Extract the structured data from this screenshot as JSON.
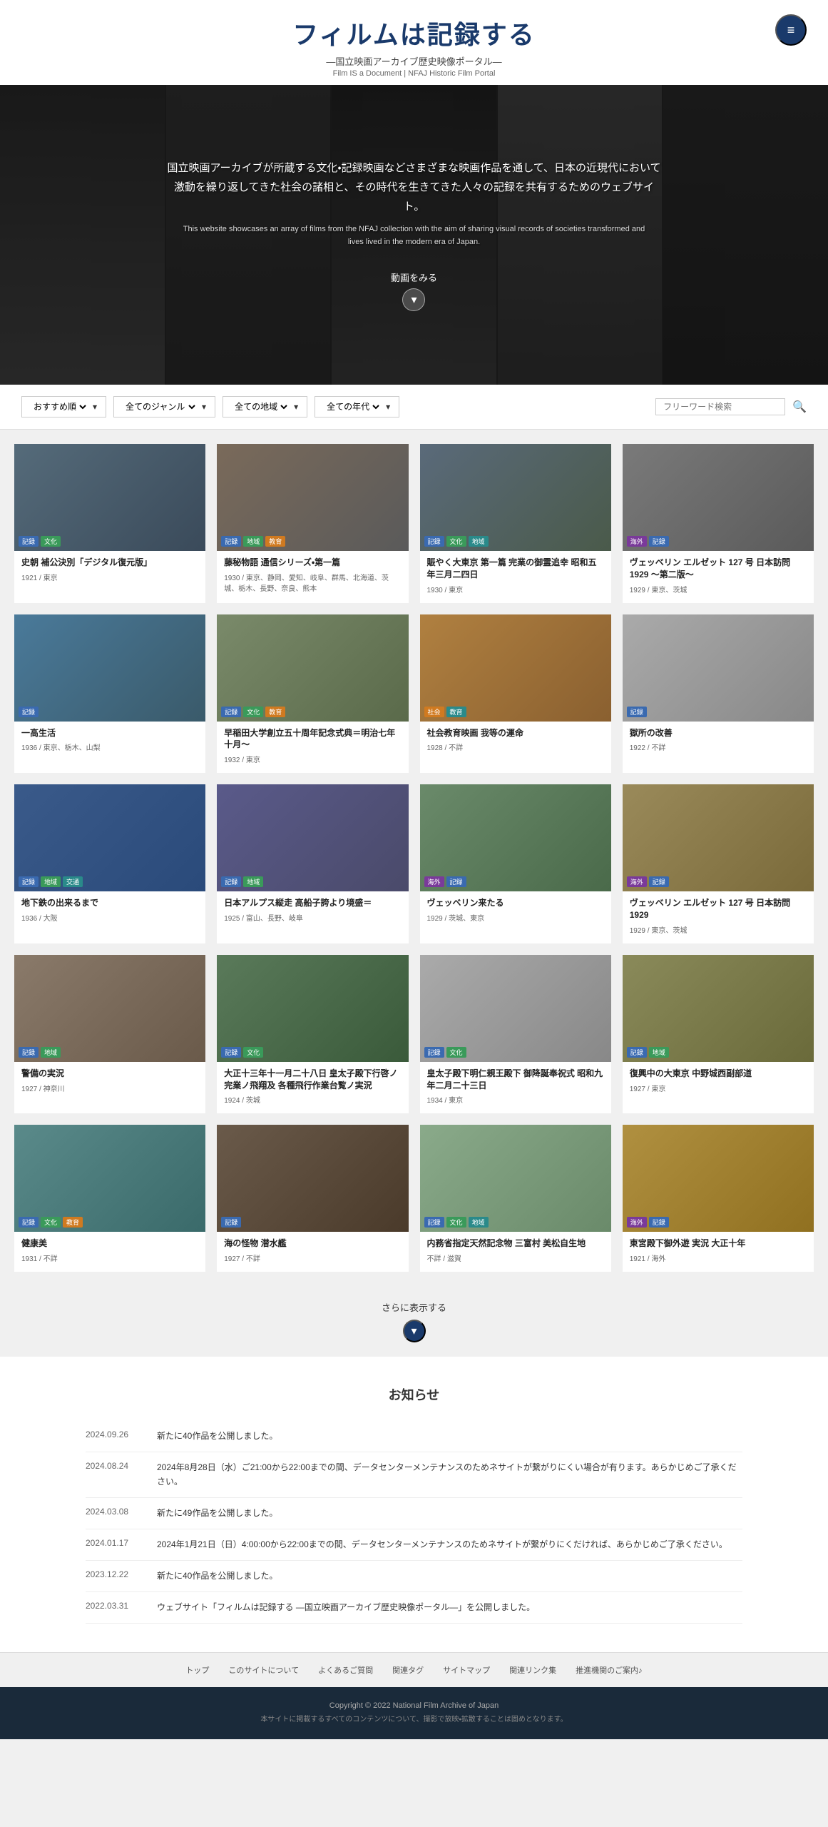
{
  "header": {
    "title": "フィルムは記録する",
    "subtitle": "―国立映画アーカイブ歴史映像ポータル―",
    "subtitle_en": "Film IS a Document | NFAJ Historic Film Portal",
    "menu_icon": "≡"
  },
  "hero": {
    "text_ja": "国立映画アーカイブが所蔵する文化・記録映画などさまざまな映画作品を通して、日本の近現代において激動を繰り返してきた社会の諸相と、その時代を生きてきた人々の記録を共有するためのウェブサイト。",
    "text_en": "This website showcases an array of films from the NFAJ collection with the aim of sharing visual records of societies transformed and lives lived in the modern era of Japan.",
    "watch_label": "動画をみる"
  },
  "filters": {
    "recommended": "おすすめ順",
    "genre": "全てのジャンル",
    "region": "全ての地域",
    "year": "全ての年代",
    "search_placeholder": "フリーワード検索"
  },
  "films": [
    {
      "id": 1,
      "thumb_class": "t1",
      "tags": [
        {
          "label": "記録",
          "color": "blue"
        },
        {
          "label": "文化",
          "color": "green"
        }
      ],
      "title": "史朝 補公決別「デジタル復元版」",
      "meta": "1921 / 東京",
      "extra_meta": ""
    },
    {
      "id": 2,
      "thumb_class": "t2",
      "tags": [
        {
          "label": "記録",
          "color": "blue"
        },
        {
          "label": "地域",
          "color": "green"
        },
        {
          "label": "教育",
          "color": "orange"
        }
      ],
      "title": "藤秘物語 通信シリーズ・第一篇",
      "meta": "1930 / 東京、静岡、愛知、岐阜、群馬、北海道、茨城、栃木、長野、奈良、熊本",
      "extra_meta": ""
    },
    {
      "id": 3,
      "thumb_class": "t3",
      "tags": [
        {
          "label": "記録",
          "color": "blue"
        },
        {
          "label": "文化",
          "color": "green"
        },
        {
          "label": "地域",
          "color": "teal"
        }
      ],
      "title": "賑やく大東京 第一篇 完業の御霊追幸 昭和五年三月二四日",
      "meta": "1930 / 東京",
      "extra_meta": ""
    },
    {
      "id": 4,
      "thumb_class": "t4",
      "tags": [
        {
          "label": "海外",
          "color": "purple"
        },
        {
          "label": "記録",
          "color": "blue"
        }
      ],
      "title": "ヴェッベリン エルゼット 127 号 日本訪問 1929 〜第二版〜",
      "meta": "1929 / 東京、茨城",
      "extra_meta": ""
    },
    {
      "id": 5,
      "thumb_class": "t5",
      "tags": [
        {
          "label": "記録",
          "color": "blue"
        }
      ],
      "title": "一高生活",
      "meta": "1936 / 東京、栃木、山梨",
      "extra_meta": ""
    },
    {
      "id": 6,
      "thumb_class": "t6",
      "tags": [
        {
          "label": "記録",
          "color": "blue"
        },
        {
          "label": "文化",
          "color": "green"
        },
        {
          "label": "教育",
          "color": "orange"
        }
      ],
      "title": "早稲田大学創立五十周年記念式典＝明治七年十月〜",
      "meta": "1932 / 東京",
      "extra_meta": ""
    },
    {
      "id": 7,
      "thumb_class": "t7",
      "tags": [
        {
          "label": "社会",
          "color": "orange"
        },
        {
          "label": "教育",
          "color": "teal"
        }
      ],
      "title": "社会教育映画 我等の運命",
      "meta": "1928 / 不詳",
      "extra_meta": ""
    },
    {
      "id": 8,
      "thumb_class": "t8",
      "tags": [
        {
          "label": "記録",
          "color": "blue"
        }
      ],
      "title": "獄所の改善",
      "meta": "1922 / 不詳",
      "extra_meta": ""
    },
    {
      "id": 9,
      "thumb_class": "t9",
      "tags": [
        {
          "label": "記録",
          "color": "blue"
        },
        {
          "label": "地域",
          "color": "green"
        },
        {
          "label": "交通",
          "color": "teal"
        }
      ],
      "title": "地下鉄の出来るまで",
      "meta": "1936 / 大阪",
      "extra_meta": ""
    },
    {
      "id": 10,
      "thumb_class": "t10",
      "tags": [
        {
          "label": "記録",
          "color": "blue"
        },
        {
          "label": "地域",
          "color": "green"
        }
      ],
      "title": "日本アルプス縦走 高船子誇より境盛＝",
      "meta": "1925 / 富山、長野、岐阜",
      "extra_meta": ""
    },
    {
      "id": 11,
      "thumb_class": "t11",
      "tags": [
        {
          "label": "海外",
          "color": "purple"
        },
        {
          "label": "記録",
          "color": "blue"
        }
      ],
      "title": "ヴェッベリン来たる",
      "meta": "1929 / 茨城、東京",
      "extra_meta": ""
    },
    {
      "id": 12,
      "thumb_class": "t12",
      "tags": [
        {
          "label": "海外",
          "color": "purple"
        },
        {
          "label": "記録",
          "color": "blue"
        }
      ],
      "title": "ヴェッベリン エルゼット 127 号 日本訪問 1929",
      "meta": "1929 / 東京、茨城",
      "extra_meta": ""
    },
    {
      "id": 13,
      "thumb_class": "t13",
      "tags": [
        {
          "label": "記録",
          "color": "blue"
        },
        {
          "label": "地域",
          "color": "green"
        }
      ],
      "title": "警備の実況",
      "meta": "1927 / 神奈川",
      "extra_meta": ""
    },
    {
      "id": 14,
      "thumb_class": "t14",
      "tags": [
        {
          "label": "記録",
          "color": "blue"
        },
        {
          "label": "文化",
          "color": "green"
        }
      ],
      "title": "大正十三年十一月二十八日 皇太子殿下行啓ノ完業ノ飛翔及 各種飛行作業台覧ノ実況",
      "meta": "1924 / 茨城",
      "extra_meta": ""
    },
    {
      "id": 15,
      "thumb_class": "t15",
      "tags": [
        {
          "label": "記録",
          "color": "blue"
        },
        {
          "label": "文化",
          "color": "green"
        }
      ],
      "title": "皇太子殿下明仁親王殿下 御降誕奉祝式 昭和九年二月二十三日",
      "meta": "1934 / 東京",
      "extra_meta": ""
    },
    {
      "id": 16,
      "thumb_class": "t16",
      "tags": [
        {
          "label": "記録",
          "color": "blue"
        },
        {
          "label": "地域",
          "color": "green"
        }
      ],
      "title": "復興中の大東京 中野城西副部道",
      "meta": "1927 / 東京",
      "extra_meta": ""
    },
    {
      "id": 17,
      "thumb_class": "t17",
      "tags": [
        {
          "label": "記録",
          "color": "blue"
        },
        {
          "label": "文化",
          "color": "green"
        },
        {
          "label": "教育",
          "color": "orange"
        }
      ],
      "title": "健康美",
      "meta": "1931 / 不詳",
      "extra_meta": ""
    },
    {
      "id": 18,
      "thumb_class": "t18",
      "tags": [
        {
          "label": "記録",
          "color": "blue"
        }
      ],
      "title": "海の怪物 潜水艦",
      "meta": "1927 / 不詳",
      "extra_meta": ""
    },
    {
      "id": 19,
      "thumb_class": "t19",
      "tags": [
        {
          "label": "記録",
          "color": "blue"
        },
        {
          "label": "文化",
          "color": "green"
        },
        {
          "label": "地域",
          "color": "teal"
        }
      ],
      "title": "内務省指定天然記念物 三富村 美松自生地",
      "meta": "不詳 / 滋賀",
      "extra_meta": ""
    },
    {
      "id": 20,
      "thumb_class": "t20",
      "tags": [
        {
          "label": "海外",
          "color": "purple"
        },
        {
          "label": "記録",
          "color": "blue"
        }
      ],
      "title": "東宮殿下御外遊 実況 大正十年",
      "meta": "1921 / 海外",
      "extra_meta": ""
    }
  ],
  "load_more": {
    "label": "さらに表示する"
  },
  "news": {
    "section_title": "お知らせ",
    "items": [
      {
        "date": "2024.09.26",
        "text": "新たに40作品を公開しました。"
      },
      {
        "date": "2024.08.24",
        "text": "2024年8月28日（水）ご21:00から22:00までの間、データセンターメンテナンスのためネサイトが繋がりにくい場合が有ります。あらかじめご了承ください。"
      },
      {
        "date": "2024.03.08",
        "text": "新たに49作品を公開しました。"
      },
      {
        "date": "2024.01.17",
        "text": "2024年1月21日（日）4:00:00から22:00までの間、データセンターメンテナンスのためネサイトが繋がりにくだければ、あらかじめご了承ください。"
      },
      {
        "date": "2023.12.22",
        "text": "新たに40作品を公開しました。"
      },
      {
        "date": "2022.03.31",
        "text": "ウェブサイト「フィルムは記録する ―国立映画アーカイブ歴史映像ポータル―」を公開しました。"
      }
    ]
  },
  "footer_nav": {
    "links": [
      {
        "label": "トップ"
      },
      {
        "label": "このサイトについて"
      },
      {
        "label": "よくあるご質問"
      },
      {
        "label": "関連タグ"
      },
      {
        "label": "サイトマップ"
      },
      {
        "label": "関連リンク集"
      },
      {
        "label": "推進機関のご案内♪"
      }
    ]
  },
  "footer": {
    "copyright": "Copyright © 2022 National Film Archive of Japan",
    "disclaimer": "本サイトに掲載するすべてのコンテンツについて、撮影で放映・拡散することは固めとなります。"
  }
}
